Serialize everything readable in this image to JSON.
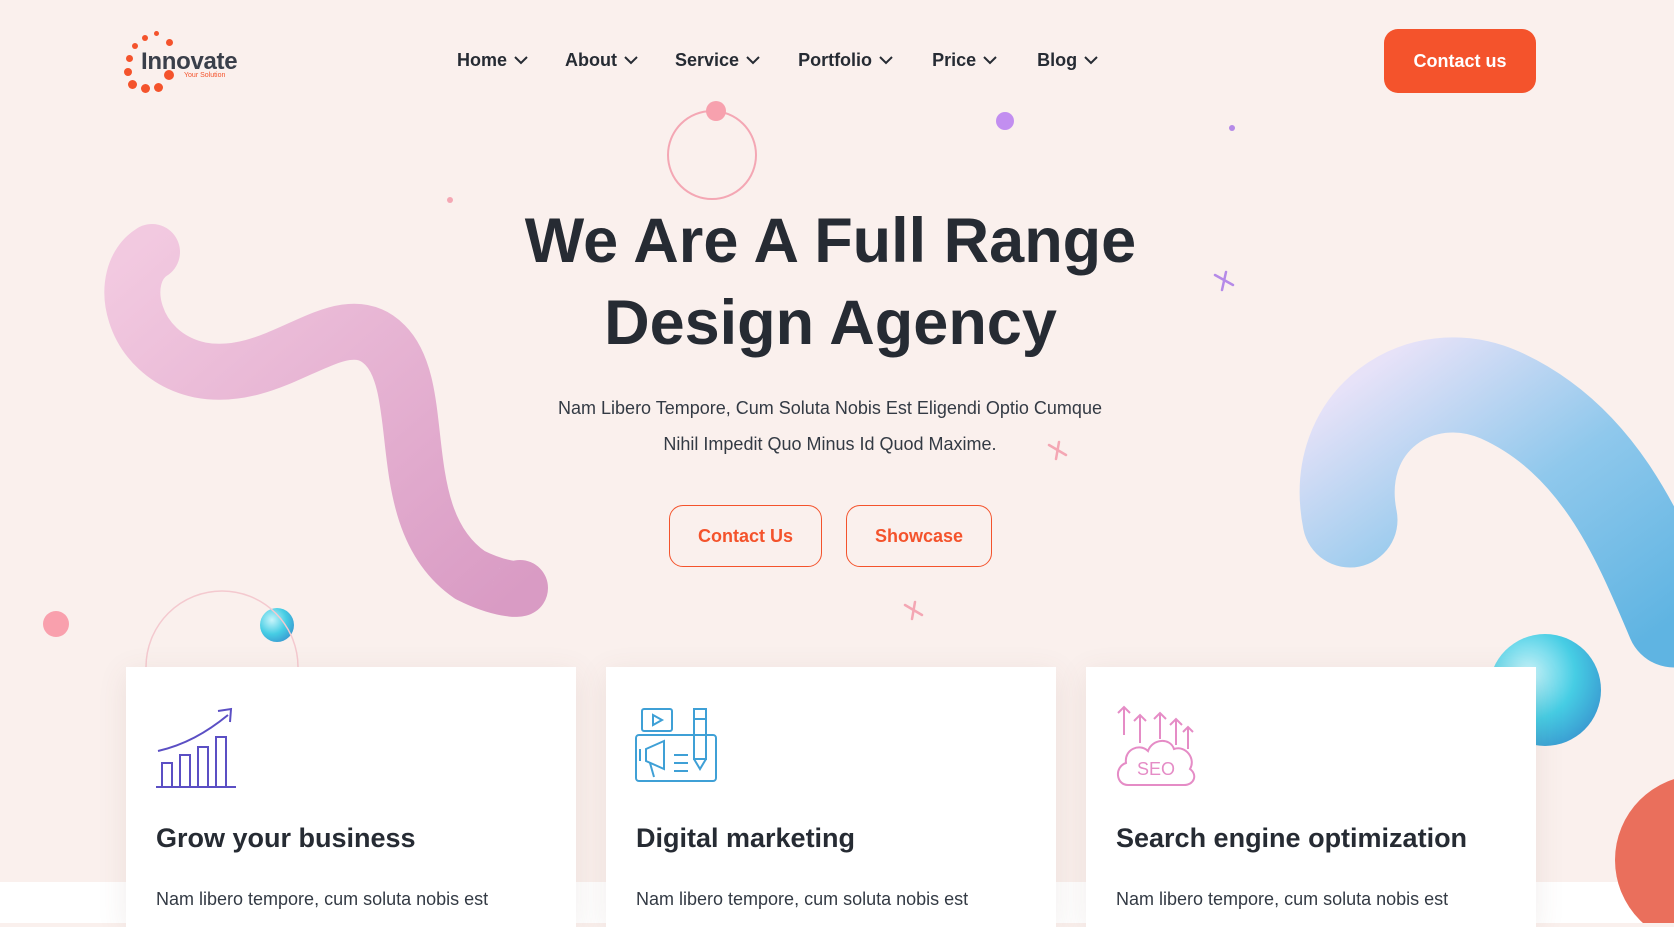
{
  "brand": {
    "name": "Innovate",
    "tagline": "Your Solution",
    "accent": "#f4532c"
  },
  "nav": {
    "items": [
      {
        "label": "Home"
      },
      {
        "label": "About"
      },
      {
        "label": "Service"
      },
      {
        "label": "Portfolio"
      },
      {
        "label": "Price"
      },
      {
        "label": "Blog"
      }
    ],
    "contact_label": "Contact us"
  },
  "hero": {
    "title_line1": "We Are A Full Range",
    "title_line2": "Design Agency",
    "subtitle_line1": "Nam Libero Tempore, Cum Soluta Nobis Est Eligendi Optio Cumque",
    "subtitle_line2": "Nihil Impedit Quo Minus Id Quod Maxime.",
    "btn_contact": "Contact Us",
    "btn_showcase": "Showcase"
  },
  "services": [
    {
      "icon": "growth-chart-icon",
      "title": "Grow your business",
      "text": "Nam libero tempore, cum soluta nobis est"
    },
    {
      "icon": "digital-marketing-icon",
      "title": "Digital marketing",
      "text": "Nam libero tempore, cum soluta nobis est"
    },
    {
      "icon": "seo-cloud-icon",
      "icon_text": "SEO",
      "title": "Search engine optimization",
      "text": "Nam libero tempore, cum soluta nobis est"
    }
  ],
  "colors": {
    "background": "#faf0ed",
    "text": "#262b33",
    "accent": "#f4532c",
    "icon_purple": "#5b4fc4",
    "icon_blue": "#3fa0d6",
    "icon_pink": "#e58cc6"
  }
}
